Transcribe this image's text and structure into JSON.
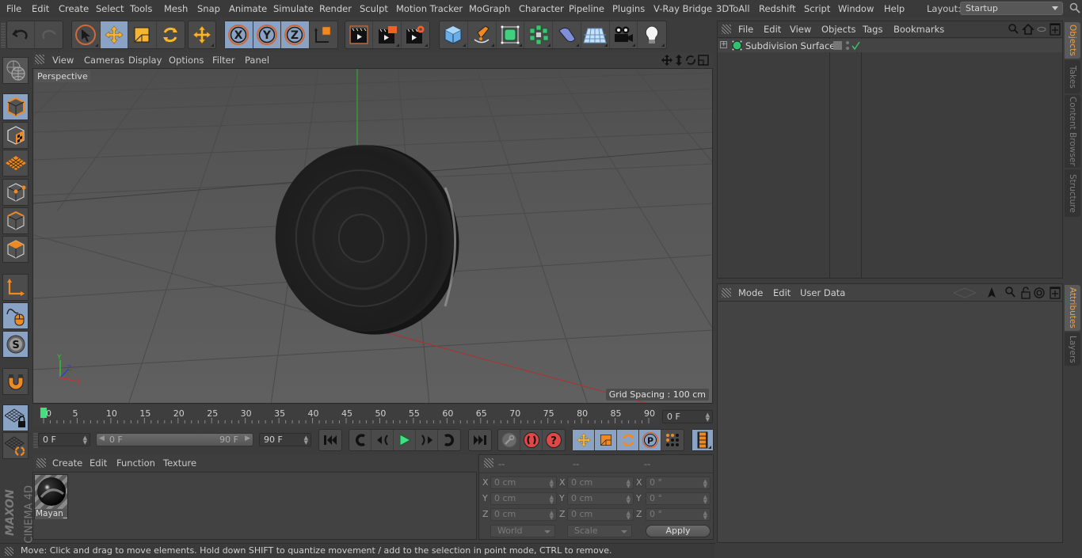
{
  "menubar": {
    "items": [
      "File",
      "Edit",
      "Create",
      "Select",
      "Tools",
      "Mesh",
      "Snap",
      "Animate",
      "Simulate",
      "Render",
      "Sculpt",
      "Motion Tracker",
      "MoGraph",
      "Character",
      "Pipeline",
      "Plugins",
      "V-Ray Bridge",
      "3DToAll",
      "Redshift",
      "Script",
      "Window",
      "Help"
    ],
    "layout_label": "Layout:",
    "layout_value": "Startup"
  },
  "toolbar": {
    "undo": "undo-icon",
    "redo": "redo-icon",
    "tools": [
      "live-selection",
      "move",
      "scale",
      "rotate",
      "recent-tools"
    ],
    "axes": [
      "X",
      "Y",
      "Z"
    ],
    "coord_system": "world-coordinate-system",
    "render": [
      "render-view",
      "render-to-picture-viewer",
      "render-settings"
    ],
    "objects": [
      "cube",
      "pen-spline",
      "subdivision-surface",
      "cloner",
      "deformer",
      "floor",
      "camera",
      "light"
    ]
  },
  "viewport": {
    "menu": [
      "View",
      "Cameras",
      "Display",
      "Options",
      "Filter",
      "Panel"
    ],
    "camera_label": "Perspective",
    "grid_spacing": "Grid Spacing : 100 cm",
    "axis_labels": {
      "x": "X",
      "y": "Y",
      "z": "Z"
    }
  },
  "left_toolbar": {
    "items": [
      "model-mode",
      "texture-mode",
      "workplane-mode",
      "points-mode",
      "edges-mode",
      "polygons-mode",
      "axis-mode",
      "tweak-mode",
      "solo-mode",
      "snapping",
      "workplane-lock",
      "workplane-align"
    ],
    "brand_top": "MAXON",
    "brand_bottom": "CINEMA 4D"
  },
  "timeline": {
    "ticks": [
      "0",
      "5",
      "10",
      "15",
      "20",
      "25",
      "30",
      "35",
      "40",
      "45",
      "50",
      "55",
      "60",
      "65",
      "70",
      "75",
      "80",
      "85",
      "90"
    ],
    "current_frame": "0 F",
    "start_frame": "0 F",
    "range_start": "0 F",
    "range_end": "90 F",
    "end_frame": "90 F"
  },
  "materials": {
    "menu": [
      "Create",
      "Edit",
      "Function",
      "Texture"
    ],
    "items": [
      {
        "name": "Mayan_("
      }
    ]
  },
  "coordinates": {
    "headers": [
      "--",
      "--",
      "--"
    ],
    "rows": [
      {
        "axis": "X",
        "pos": "0 cm",
        "size": "0 cm",
        "rot": "0 °"
      },
      {
        "axis": "Y",
        "pos": "0 cm",
        "size": "0 cm",
        "rot": "0 °"
      },
      {
        "axis": "Z",
        "pos": "0 cm",
        "size": "0 cm",
        "rot": "0 °"
      }
    ],
    "mode_select": "World",
    "type_select": "Scale",
    "apply_label": "Apply"
  },
  "status": {
    "text": "Move: Click and drag to move elements. Hold down SHIFT to quantize movement / add to the selection in point mode, CTRL to remove."
  },
  "objects_panel": {
    "menu": [
      "File",
      "Edit",
      "View",
      "Objects",
      "Tags",
      "Bookmarks"
    ],
    "items": [
      {
        "name": "Subdivision Surface",
        "enabled": true
      }
    ]
  },
  "attributes_panel": {
    "menu": [
      "Mode",
      "Edit",
      "User Data"
    ]
  },
  "side_tabs": {
    "top": [
      {
        "label": "Objects",
        "active": true
      },
      {
        "label": "Takes",
        "active": false
      },
      {
        "label": "Content Browser",
        "active": false
      },
      {
        "label": "Structure",
        "active": false
      }
    ],
    "bottom": [
      {
        "label": "Attributes",
        "active": true
      },
      {
        "label": "Layers",
        "active": false
      }
    ]
  },
  "colors": {
    "accent_blue": "#8aa3c4",
    "tab_active": "#f0a040",
    "axis_x": "#d03030",
    "axis_y": "#30c030",
    "axis_z": "#3040d0",
    "play_green": "#40e080",
    "record_red": "#e04848"
  }
}
